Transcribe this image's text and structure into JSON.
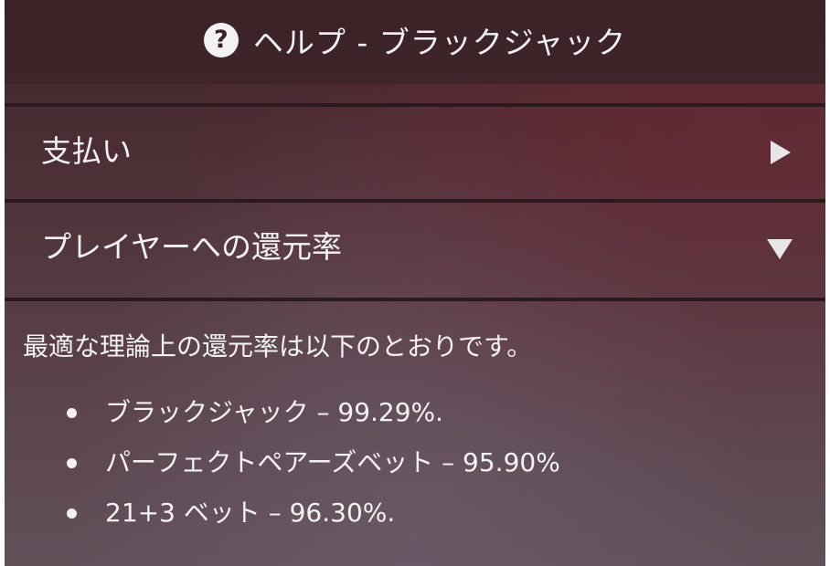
{
  "header": {
    "help_icon": "?",
    "title": "ヘルプ - ブラックジャック"
  },
  "sections": [
    {
      "label": "支払い",
      "state": "collapsed",
      "indicator": "triangle-right-icon"
    },
    {
      "label": "プレイヤーへの還元率",
      "state": "expanded",
      "indicator": "triangle-down-icon"
    }
  ],
  "rtp": {
    "intro": "最適な理論上の還元率は以下のとおりです。",
    "items": [
      "ブラックジャック – 99.29%.",
      "パーフェクトペアーズベット – 95.90%",
      "21+3 ベット – 96.30%."
    ]
  },
  "colors": {
    "header_bg": "#3a2226",
    "panel_bg": "#4d3036",
    "text": "#f2f2f2",
    "divider": "#2a1a1d"
  }
}
